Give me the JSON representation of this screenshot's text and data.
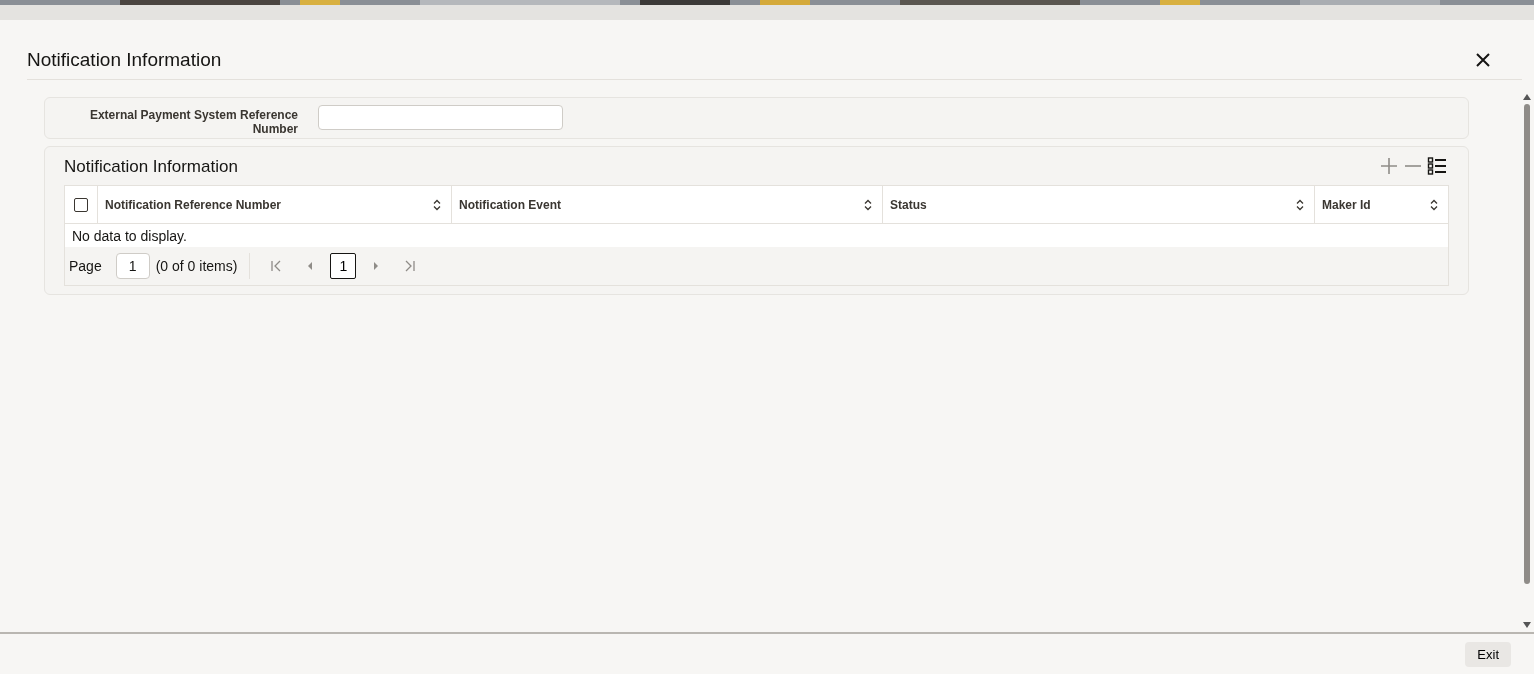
{
  "window": {
    "title": "Notification Information"
  },
  "form": {
    "fields": [
      {
        "label": "External Payment System Reference Number"
      }
    ]
  },
  "section": {
    "title": "Notification Information",
    "table": {
      "select_all": {
        "checked": false
      },
      "columns": [
        {
          "label": "Notification Reference Number"
        },
        {
          "label": "Notification Event"
        },
        {
          "label": "Status"
        },
        {
          "label": "Maker Id"
        }
      ],
      "empty_message": "No data to display.",
      "pagination": {
        "page_label": "Page",
        "page": "1",
        "summary": "(0 of 0 items)",
        "current": "1"
      }
    }
  },
  "footer": {
    "buttons": [
      "Exit"
    ]
  }
}
